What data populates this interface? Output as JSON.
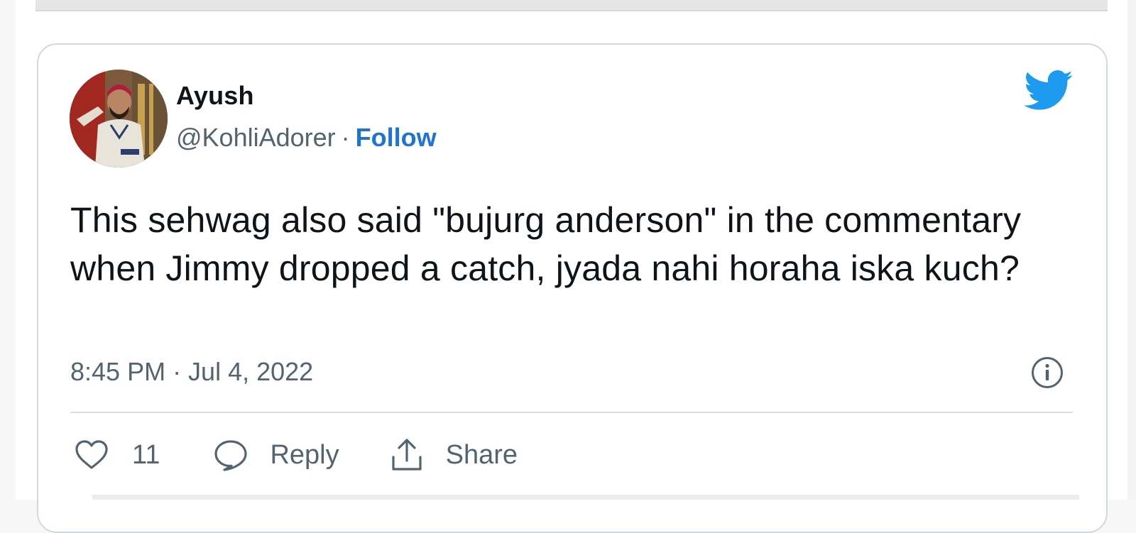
{
  "tweet": {
    "display_name": "Ayush",
    "handle": "@KohliAdorer",
    "separator": "·",
    "follow_label": "Follow",
    "text": "This sehwag also said \"bujurg anderson\" in the commentary when Jimmy dropped a catch, jyada nahi horaha iska kuch?",
    "timestamp": "8:45 PM · Jul 4, 2022"
  },
  "actions": {
    "like_count": "11",
    "reply_label": "Reply",
    "share_label": "Share"
  },
  "icons": {
    "brand": "twitter-bird-icon",
    "info": "info-icon",
    "like": "heart-icon",
    "reply": "speech-bubble-icon",
    "share": "share-upload-icon"
  },
  "colors": {
    "brand": "#1d9bf0",
    "follow": "#1d74d6",
    "text": "#0f1419",
    "muted": "#536471",
    "border": "#cfd9de"
  }
}
